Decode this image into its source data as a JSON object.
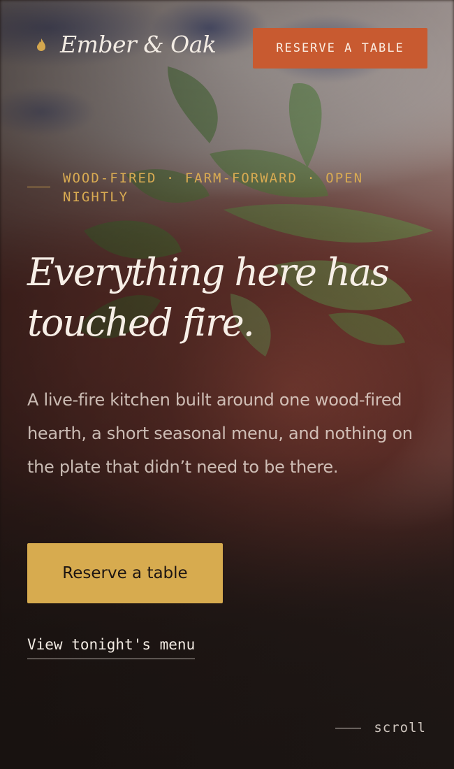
{
  "header": {
    "brand_name": "Ember & Oak",
    "logo_icon": "flame-icon",
    "cta_label": "RESERVE A TABLE"
  },
  "hero": {
    "eyebrow": "WOOD-FIRED · FARM-FORWARD · OPEN NIGHTLY",
    "headline": "Everything here has touched fire.",
    "lead": "A live-fire kitchen built around one wood-fired hearth, a short seasonal menu, and nothing on the plate that didn’t need to be there.",
    "primary_cta": "Reserve a table",
    "secondary_link": "View tonight's menu"
  },
  "scroll": {
    "label": "scroll"
  },
  "colors": {
    "accent_orange": "#c85a30",
    "accent_gold": "#d7ab4f",
    "text_light": "#f2ebe3",
    "background_dark": "#1c1614"
  }
}
